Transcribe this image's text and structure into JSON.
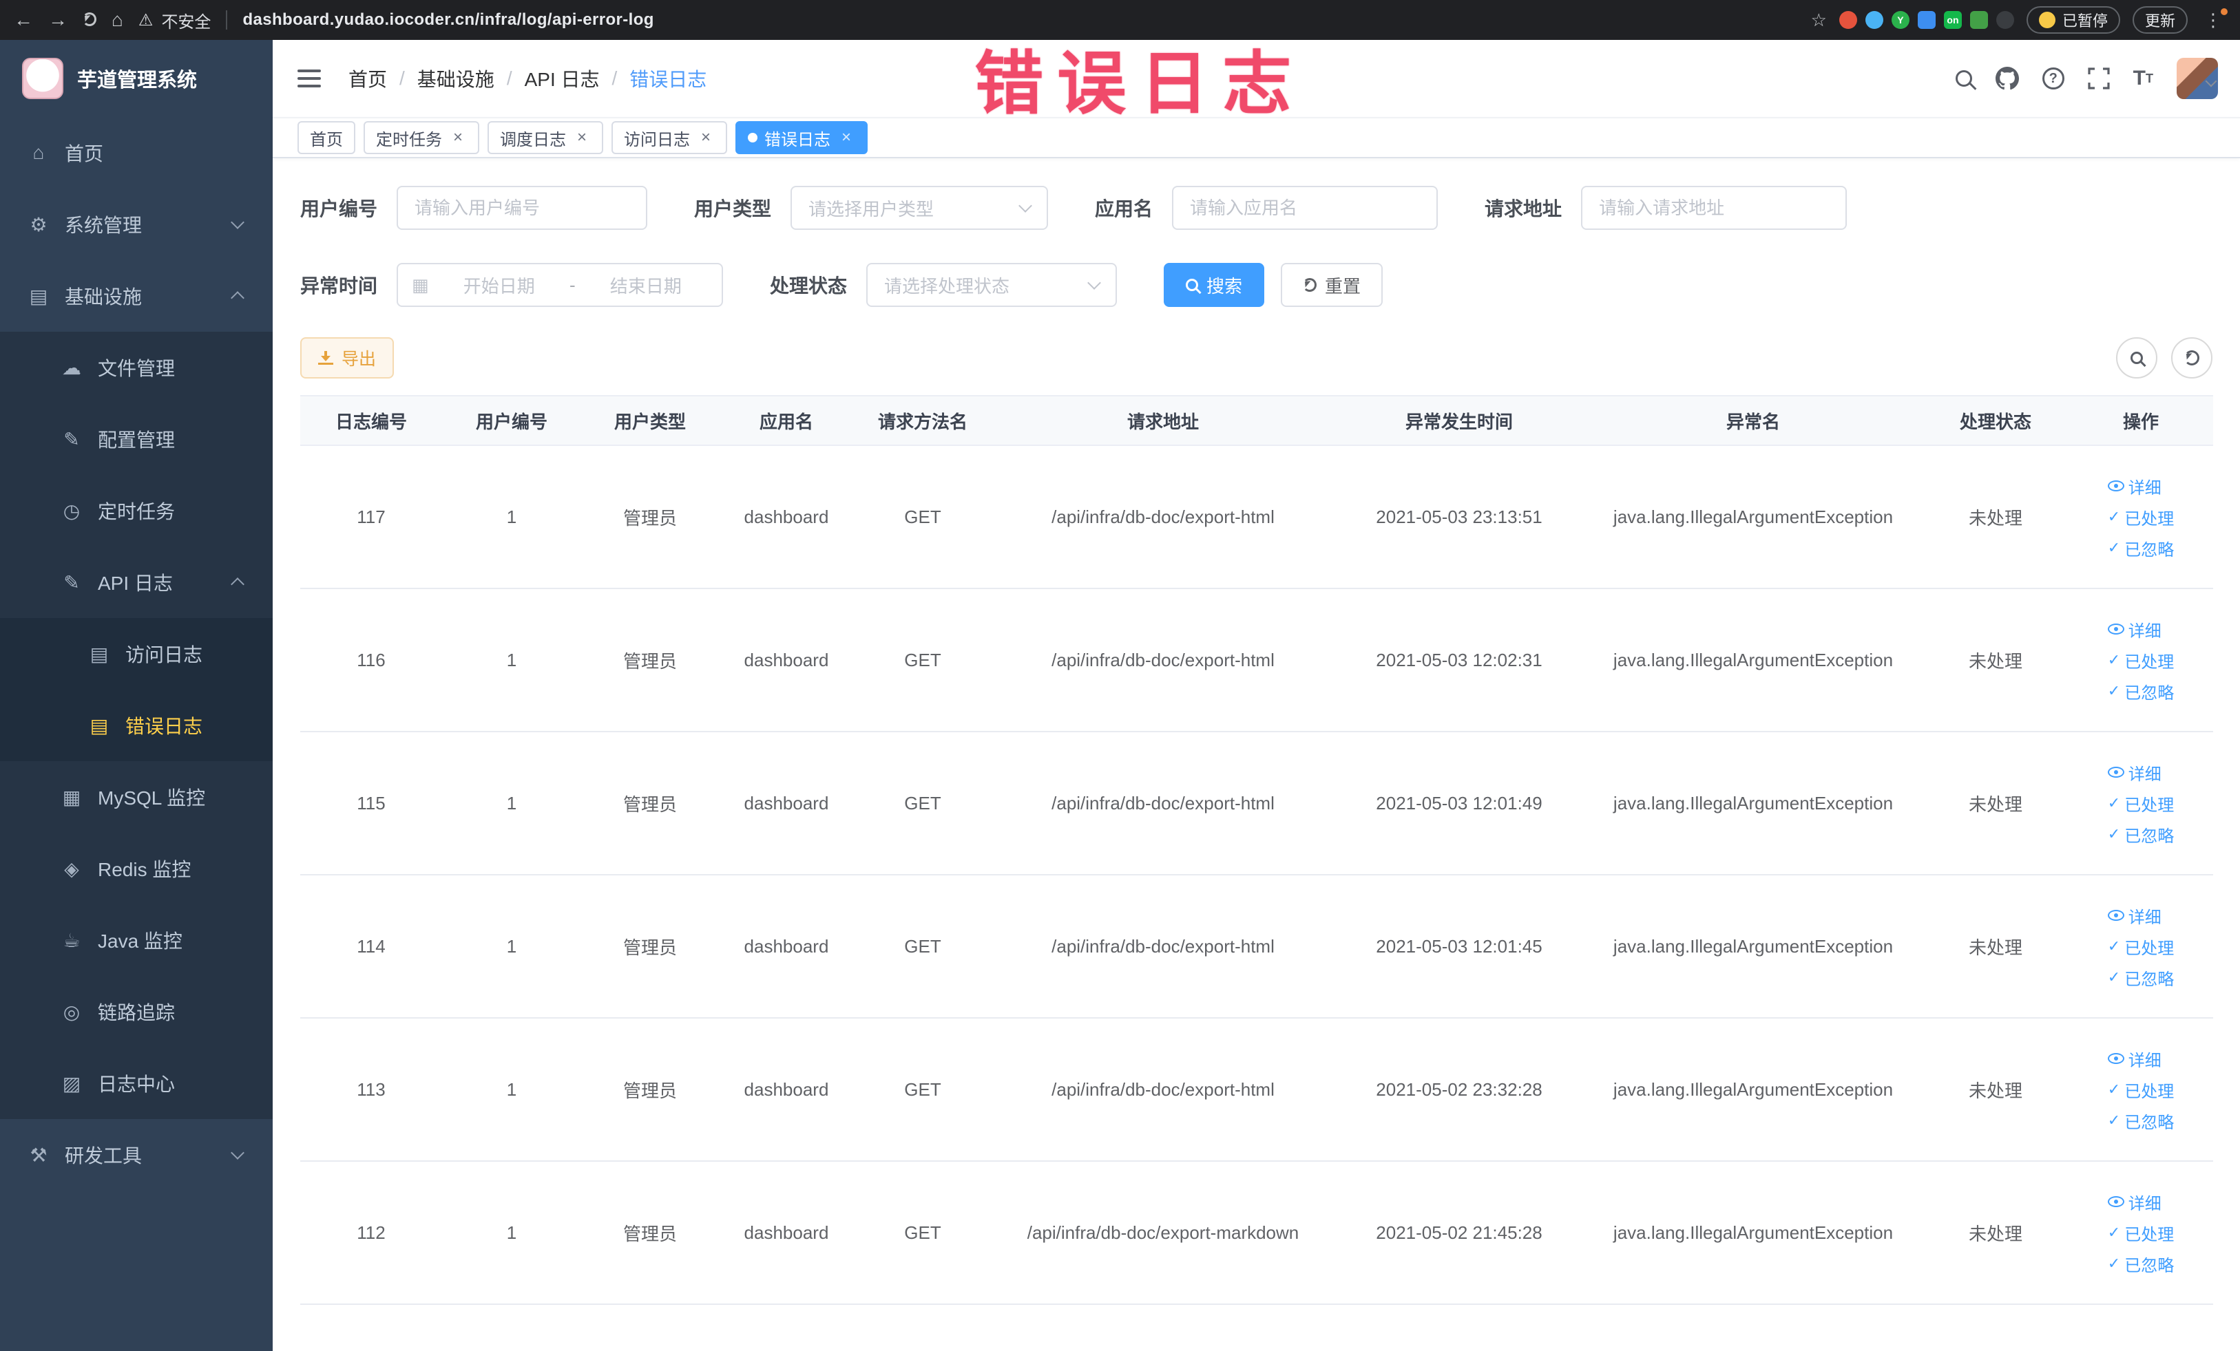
{
  "browser": {
    "security_text": "不安全",
    "url": "dashboard.yudao.iocoder.cn/infra/log/api-error-log",
    "paused_label": "已暂停",
    "update_label": "更新",
    "extensions": [
      {
        "id": "orange",
        "color": "#e5533d",
        "round": true,
        "text": ""
      },
      {
        "id": "blue-drop",
        "color": "#4ab3f4",
        "round": true,
        "text": ""
      },
      {
        "id": "green-y",
        "color": "#2bb24c",
        "round": true,
        "text": "Y"
      },
      {
        "id": "blue-grid",
        "color": "#3d8ef0",
        "round": false,
        "text": ""
      },
      {
        "id": "on-badge",
        "color": "#14b84b",
        "round": false,
        "text": "on"
      },
      {
        "id": "green-leaf",
        "color": "#43a047",
        "round": false,
        "text": ""
      },
      {
        "id": "pin",
        "color": "#3a3d41",
        "round": true,
        "text": ""
      }
    ]
  },
  "watermark": "错误日志",
  "sidebar": {
    "logo_title": "芋道管理系统",
    "items": [
      {
        "id": "home",
        "label": "首页",
        "icon": "home",
        "level": 0
      },
      {
        "id": "system-mgmt",
        "label": "系统管理",
        "icon": "gear",
        "level": 0,
        "chevron": "down"
      },
      {
        "id": "infrastructure",
        "label": "基础设施",
        "icon": "infra",
        "level": 0,
        "chevron": "up"
      },
      {
        "id": "file-mgmt",
        "label": "文件管理",
        "icon": "file",
        "level": 1
      },
      {
        "id": "config-mgmt",
        "label": "配置管理",
        "icon": "config",
        "level": 1
      },
      {
        "id": "scheduled-task",
        "label": "定时任务",
        "icon": "timer",
        "level": 1
      },
      {
        "id": "api-log",
        "label": "API 日志",
        "icon": "api-log",
        "level": 1,
        "chevron": "up"
      },
      {
        "id": "access-log",
        "label": "访问日志",
        "icon": "doc",
        "level": 2
      },
      {
        "id": "error-log",
        "label": "错误日志",
        "icon": "doc",
        "level": 2,
        "active": true
      },
      {
        "id": "mysql-monitor",
        "label": "MySQL 监控",
        "icon": "mysql",
        "level": 1
      },
      {
        "id": "redis-monitor",
        "label": "Redis 监控",
        "icon": "redis",
        "level": 1
      },
      {
        "id": "java-monitor",
        "label": "Java 监控",
        "icon": "java",
        "level": 1
      },
      {
        "id": "trace",
        "label": "链路追踪",
        "icon": "trace",
        "level": 1
      },
      {
        "id": "log-center",
        "label": "日志中心",
        "icon": "log-center",
        "level": 1
      },
      {
        "id": "dev-tools",
        "label": "研发工具",
        "icon": "tools",
        "level": 0,
        "chevron": "down"
      }
    ]
  },
  "breadcrumb": [
    "首页",
    "基础设施",
    "API 日志",
    "错误日志"
  ],
  "tabs": [
    {
      "id": "home",
      "label": "首页",
      "closable": false,
      "active": false
    },
    {
      "id": "scheduled-task",
      "label": "定时任务",
      "closable": true,
      "active": false
    },
    {
      "id": "schedule-log",
      "label": "调度日志",
      "closable": true,
      "active": false
    },
    {
      "id": "access-log",
      "label": "访问日志",
      "closable": true,
      "active": false
    },
    {
      "id": "error-log",
      "label": "错误日志",
      "closable": true,
      "active": true
    }
  ],
  "filters": {
    "user_id_label": "用户编号",
    "user_id_placeholder": "请输入用户编号",
    "user_type_label": "用户类型",
    "user_type_placeholder": "请选择用户类型",
    "app_name_label": "应用名",
    "app_name_placeholder": "请输入应用名",
    "request_url_label": "请求地址",
    "request_url_placeholder": "请输入请求地址",
    "exception_time_label": "异常时间",
    "start_date_placeholder": "开始日期",
    "date_separator": "-",
    "end_date_placeholder": "结束日期",
    "process_status_label": "处理状态",
    "process_status_placeholder": "请选择处理状态",
    "search_label": "搜索",
    "reset_label": "重置"
  },
  "toolbar": {
    "export_label": "导出"
  },
  "table": {
    "headers": [
      "日志编号",
      "用户编号",
      "用户类型",
      "应用名",
      "请求方法名",
      "请求地址",
      "异常发生时间",
      "异常名",
      "处理状态",
      "操作"
    ],
    "actions": [
      {
        "label": "详细",
        "icon": "eye"
      },
      {
        "label": "已处理",
        "icon": "check"
      },
      {
        "label": "已忽略",
        "icon": "check"
      }
    ],
    "rows": [
      {
        "log_id": "117",
        "user_id": "1",
        "user_type": "管理员",
        "app_name": "dashboard",
        "method": "GET",
        "url": "/api/infra/db-doc/export-html",
        "time": "2021-05-03 23:13:51",
        "exception": "java.lang.IllegalArgumentException",
        "status": "未处理"
      },
      {
        "log_id": "116",
        "user_id": "1",
        "user_type": "管理员",
        "app_name": "dashboard",
        "method": "GET",
        "url": "/api/infra/db-doc/export-html",
        "time": "2021-05-03 12:02:31",
        "exception": "java.lang.IllegalArgumentException",
        "status": "未处理"
      },
      {
        "log_id": "115",
        "user_id": "1",
        "user_type": "管理员",
        "app_name": "dashboard",
        "method": "GET",
        "url": "/api/infra/db-doc/export-html",
        "time": "2021-05-03 12:01:49",
        "exception": "java.lang.IllegalArgumentException",
        "status": "未处理"
      },
      {
        "log_id": "114",
        "user_id": "1",
        "user_type": "管理员",
        "app_name": "dashboard",
        "method": "GET",
        "url": "/api/infra/db-doc/export-html",
        "time": "2021-05-03 12:01:45",
        "exception": "java.lang.IllegalArgumentException",
        "status": "未处理"
      },
      {
        "log_id": "113",
        "user_id": "1",
        "user_type": "管理员",
        "app_name": "dashboard",
        "method": "GET",
        "url": "/api/infra/db-doc/export-html",
        "time": "2021-05-02 23:32:28",
        "exception": "java.lang.IllegalArgumentException",
        "status": "未处理"
      },
      {
        "log_id": "112",
        "user_id": "1",
        "user_type": "管理员",
        "app_name": "dashboard",
        "method": "GET",
        "url": "/api/infra/db-doc/export-markdown",
        "time": "2021-05-02 21:45:28",
        "exception": "java.lang.IllegalArgumentException",
        "status": "未处理"
      }
    ]
  },
  "colors": {
    "accent_blue": "#409eff",
    "sidebar_bg": "#304156",
    "active_menu": "#ffd04b",
    "warning_btn_text": "#e6a23c",
    "watermark_red": "#f04a6a"
  }
}
